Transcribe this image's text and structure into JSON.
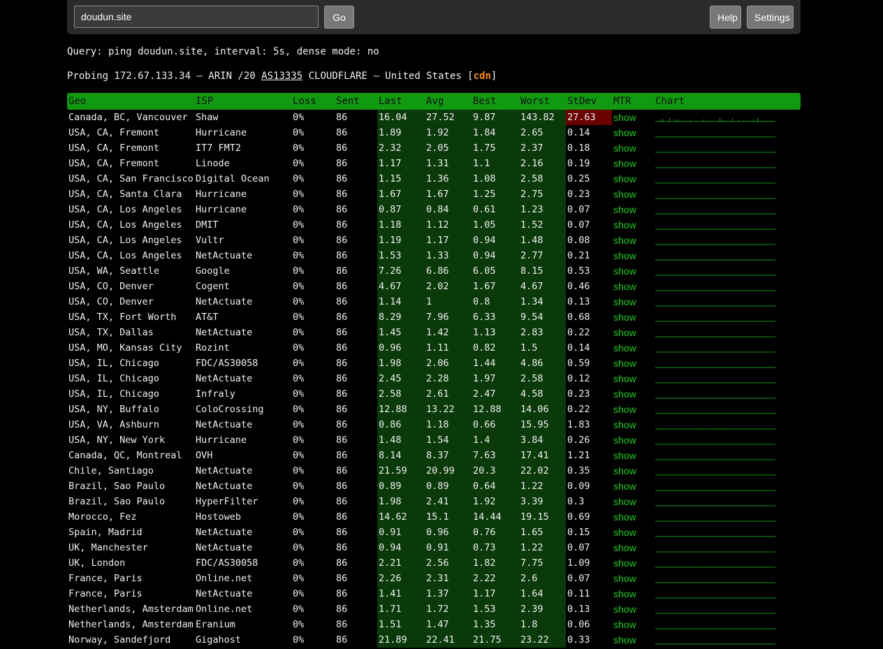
{
  "search": {
    "value": "doudun.site"
  },
  "buttons": {
    "go": "Go",
    "help": "Help",
    "settings": "Settings"
  },
  "query_line": "Query: ping doudun.site, interval: 5s, dense mode: no",
  "probe": {
    "prefix": "Probing 172.67.133.34 — ARIN /20 ",
    "asn": "AS13335",
    "middle": " CLOUDFLARE — United States [",
    "tag": "cdn",
    "suffix": "]"
  },
  "colors": {
    "header": "#119911",
    "num_bg": "#0a3a0a",
    "hot": "#6b0000",
    "link": "#22cc22",
    "tag": "#ff8c1a"
  },
  "columns": [
    "Geo",
    "ISP",
    "Loss",
    "Sent",
    "Last",
    "Avg",
    "Best",
    "Worst",
    "StDev",
    "MTR",
    "Chart"
  ],
  "rows": [
    {
      "geo": "Canada, BC, Vancouver",
      "isp": "Shaw",
      "loss": "0%",
      "sent": "86",
      "last": "16.04",
      "avg": "27.52",
      "best": "9.87",
      "worst": "143.82",
      "stdev": "27.63",
      "mtr": "show",
      "hot": true,
      "spiky": 2
    },
    {
      "geo": "USA, CA, Fremont",
      "isp": "Hurricane",
      "loss": "0%",
      "sent": "86",
      "last": "1.89",
      "avg": "1.92",
      "best": "1.84",
      "worst": "2.65",
      "stdev": "0.14",
      "mtr": "show"
    },
    {
      "geo": "USA, CA, Fremont",
      "isp": "IT7 FMT2",
      "loss": "0%",
      "sent": "86",
      "last": "2.32",
      "avg": "2.05",
      "best": "1.75",
      "worst": "2.37",
      "stdev": "0.18",
      "mtr": "show"
    },
    {
      "geo": "USA, CA, Fremont",
      "isp": "Linode",
      "loss": "0%",
      "sent": "86",
      "last": "1.17",
      "avg": "1.31",
      "best": "1.1",
      "worst": "2.16",
      "stdev": "0.19",
      "mtr": "show"
    },
    {
      "geo": "USA, CA, San Francisco",
      "isp": "Digital Ocean",
      "loss": "0%",
      "sent": "86",
      "last": "1.15",
      "avg": "1.36",
      "best": "1.08",
      "worst": "2.58",
      "stdev": "0.25",
      "mtr": "show"
    },
    {
      "geo": "USA, CA, Santa Clara",
      "isp": "Hurricane",
      "loss": "0%",
      "sent": "86",
      "last": "1.67",
      "avg": "1.67",
      "best": "1.25",
      "worst": "2.75",
      "stdev": "0.23",
      "mtr": "show"
    },
    {
      "geo": "USA, CA, Los Angeles",
      "isp": "Hurricane",
      "loss": "0%",
      "sent": "86",
      "last": "0.87",
      "avg": "0.84",
      "best": "0.61",
      "worst": "1.23",
      "stdev": "0.07",
      "mtr": "show"
    },
    {
      "geo": "USA, CA, Los Angeles",
      "isp": "DMIT",
      "loss": "0%",
      "sent": "86",
      "last": "1.18",
      "avg": "1.12",
      "best": "1.05",
      "worst": "1.52",
      "stdev": "0.07",
      "mtr": "show"
    },
    {
      "geo": "USA, CA, Los Angeles",
      "isp": "Vultr",
      "loss": "0%",
      "sent": "86",
      "last": "1.19",
      "avg": "1.17",
      "best": "0.94",
      "worst": "1.48",
      "stdev": "0.08",
      "mtr": "show"
    },
    {
      "geo": "USA, CA, Los Angeles",
      "isp": "NetActuate",
      "loss": "0%",
      "sent": "86",
      "last": "1.53",
      "avg": "1.33",
      "best": "0.94",
      "worst": "2.77",
      "stdev": "0.21",
      "mtr": "show"
    },
    {
      "geo": "USA, WA, Seattle",
      "isp": "Google",
      "loss": "0%",
      "sent": "86",
      "last": "7.26",
      "avg": "6.86",
      "best": "6.05",
      "worst": "8.15",
      "stdev": "0.53",
      "mtr": "show"
    },
    {
      "geo": "USA, CO, Denver",
      "isp": "Cogent",
      "loss": "0%",
      "sent": "86",
      "last": "4.67",
      "avg": "2.02",
      "best": "1.67",
      "worst": "4.67",
      "stdev": "0.46",
      "mtr": "show"
    },
    {
      "geo": "USA, CO, Denver",
      "isp": "NetActuate",
      "loss": "0%",
      "sent": "86",
      "last": "1.14",
      "avg": "1",
      "best": "0.8",
      "worst": "1.34",
      "stdev": "0.13",
      "mtr": "show"
    },
    {
      "geo": "USA, TX, Fort Worth",
      "isp": "AT&T",
      "loss": "0%",
      "sent": "86",
      "last": "8.29",
      "avg": "7.96",
      "best": "6.33",
      "worst": "9.54",
      "stdev": "0.68",
      "mtr": "show"
    },
    {
      "geo": "USA, TX, Dallas",
      "isp": "NetActuate",
      "loss": "0%",
      "sent": "86",
      "last": "1.45",
      "avg": "1.42",
      "best": "1.13",
      "worst": "2.83",
      "stdev": "0.22",
      "mtr": "show"
    },
    {
      "geo": "USA, MO, Kansas City",
      "isp": "Rozint",
      "loss": "0%",
      "sent": "86",
      "last": "0.96",
      "avg": "1.11",
      "best": "0.82",
      "worst": "1.5",
      "stdev": "0.14",
      "mtr": "show"
    },
    {
      "geo": "USA, IL, Chicago",
      "isp": "FDC/AS30058",
      "loss": "0%",
      "sent": "86",
      "last": "1.98",
      "avg": "2.06",
      "best": "1.44",
      "worst": "4.86",
      "stdev": "0.59",
      "mtr": "show"
    },
    {
      "geo": "USA, IL, Chicago",
      "isp": "NetActuate",
      "loss": "0%",
      "sent": "86",
      "last": "2.45",
      "avg": "2.28",
      "best": "1.97",
      "worst": "2.58",
      "stdev": "0.12",
      "mtr": "show"
    },
    {
      "geo": "USA, IL, Chicago",
      "isp": "Infraly",
      "loss": "0%",
      "sent": "86",
      "last": "2.58",
      "avg": "2.61",
      "best": "2.47",
      "worst": "4.58",
      "stdev": "0.23",
      "mtr": "show"
    },
    {
      "geo": "USA, NY, Buffalo",
      "isp": "ColoCrossing",
      "loss": "0%",
      "sent": "86",
      "last": "12.88",
      "avg": "13.22",
      "best": "12.88",
      "worst": "14.06",
      "stdev": "0.22",
      "mtr": "show",
      "spiky": 1
    },
    {
      "geo": "USA, VA, Ashburn",
      "isp": "NetActuate",
      "loss": "0%",
      "sent": "86",
      "last": "0.86",
      "avg": "1.18",
      "best": "0.66",
      "worst": "15.95",
      "stdev": "1.83",
      "mtr": "show",
      "spiky": 1
    },
    {
      "geo": "USA, NY, New York",
      "isp": "Hurricane",
      "loss": "0%",
      "sent": "86",
      "last": "1.48",
      "avg": "1.54",
      "best": "1.4",
      "worst": "3.84",
      "stdev": "0.26",
      "mtr": "show"
    },
    {
      "geo": "Canada, QC, Montreal",
      "isp": "OVH",
      "loss": "0%",
      "sent": "86",
      "last": "8.14",
      "avg": "8.37",
      "best": "7.63",
      "worst": "17.41",
      "stdev": "1.21",
      "mtr": "show",
      "spiky": 1
    },
    {
      "geo": "Chile, Santiago",
      "isp": "NetActuate",
      "loss": "0%",
      "sent": "86",
      "last": "21.59",
      "avg": "20.99",
      "best": "20.3",
      "worst": "22.02",
      "stdev": "0.35",
      "mtr": "show"
    },
    {
      "geo": "Brazil, Sao Paulo",
      "isp": "NetActuate",
      "loss": "0%",
      "sent": "86",
      "last": "0.89",
      "avg": "0.89",
      "best": "0.64",
      "worst": "1.22",
      "stdev": "0.09",
      "mtr": "show"
    },
    {
      "geo": "Brazil, Sao Paulo",
      "isp": "HyperFilter",
      "loss": "0%",
      "sent": "86",
      "last": "1.98",
      "avg": "2.41",
      "best": "1.92",
      "worst": "3.39",
      "stdev": "0.3",
      "mtr": "show"
    },
    {
      "geo": "Morocco, Fez",
      "isp": "Hostoweb",
      "loss": "0%",
      "sent": "86",
      "last": "14.62",
      "avg": "15.1",
      "best": "14.44",
      "worst": "19.15",
      "stdev": "0.69",
      "mtr": "show"
    },
    {
      "geo": "Spain, Madrid",
      "isp": "NetActuate",
      "loss": "0%",
      "sent": "86",
      "last": "0.91",
      "avg": "0.96",
      "best": "0.76",
      "worst": "1.65",
      "stdev": "0.15",
      "mtr": "show"
    },
    {
      "geo": "UK, Manchester",
      "isp": "NetActuate",
      "loss": "0%",
      "sent": "86",
      "last": "0.94",
      "avg": "0.91",
      "best": "0.73",
      "worst": "1.22",
      "stdev": "0.07",
      "mtr": "show"
    },
    {
      "geo": "UK, London",
      "isp": "FDC/AS30058",
      "loss": "0%",
      "sent": "86",
      "last": "2.21",
      "avg": "2.56",
      "best": "1.82",
      "worst": "7.75",
      "stdev": "1.09",
      "mtr": "show",
      "spiky": 1
    },
    {
      "geo": "France, Paris",
      "isp": "Online.net",
      "loss": "0%",
      "sent": "86",
      "last": "2.26",
      "avg": "2.31",
      "best": "2.22",
      "worst": "2.6",
      "stdev": "0.07",
      "mtr": "show"
    },
    {
      "geo": "France, Paris",
      "isp": "NetActuate",
      "loss": "0%",
      "sent": "86",
      "last": "1.41",
      "avg": "1.37",
      "best": "1.17",
      "worst": "1.64",
      "stdev": "0.11",
      "mtr": "show"
    },
    {
      "geo": "Netherlands, Amsterdam",
      "isp": "Online.net",
      "loss": "0%",
      "sent": "86",
      "last": "1.71",
      "avg": "1.72",
      "best": "1.53",
      "worst": "2.39",
      "stdev": "0.13",
      "mtr": "show"
    },
    {
      "geo": "Netherlands, Amsterdam",
      "isp": "Eranium",
      "loss": "0%",
      "sent": "86",
      "last": "1.51",
      "avg": "1.47",
      "best": "1.35",
      "worst": "1.8",
      "stdev": "0.06",
      "mtr": "show"
    },
    {
      "geo": "Norway, Sandefjord",
      "isp": "Gigahost",
      "loss": "0%",
      "sent": "86",
      "last": "21.89",
      "avg": "22.41",
      "best": "21.75",
      "worst": "23.22",
      "stdev": "0.33",
      "mtr": "show"
    }
  ]
}
